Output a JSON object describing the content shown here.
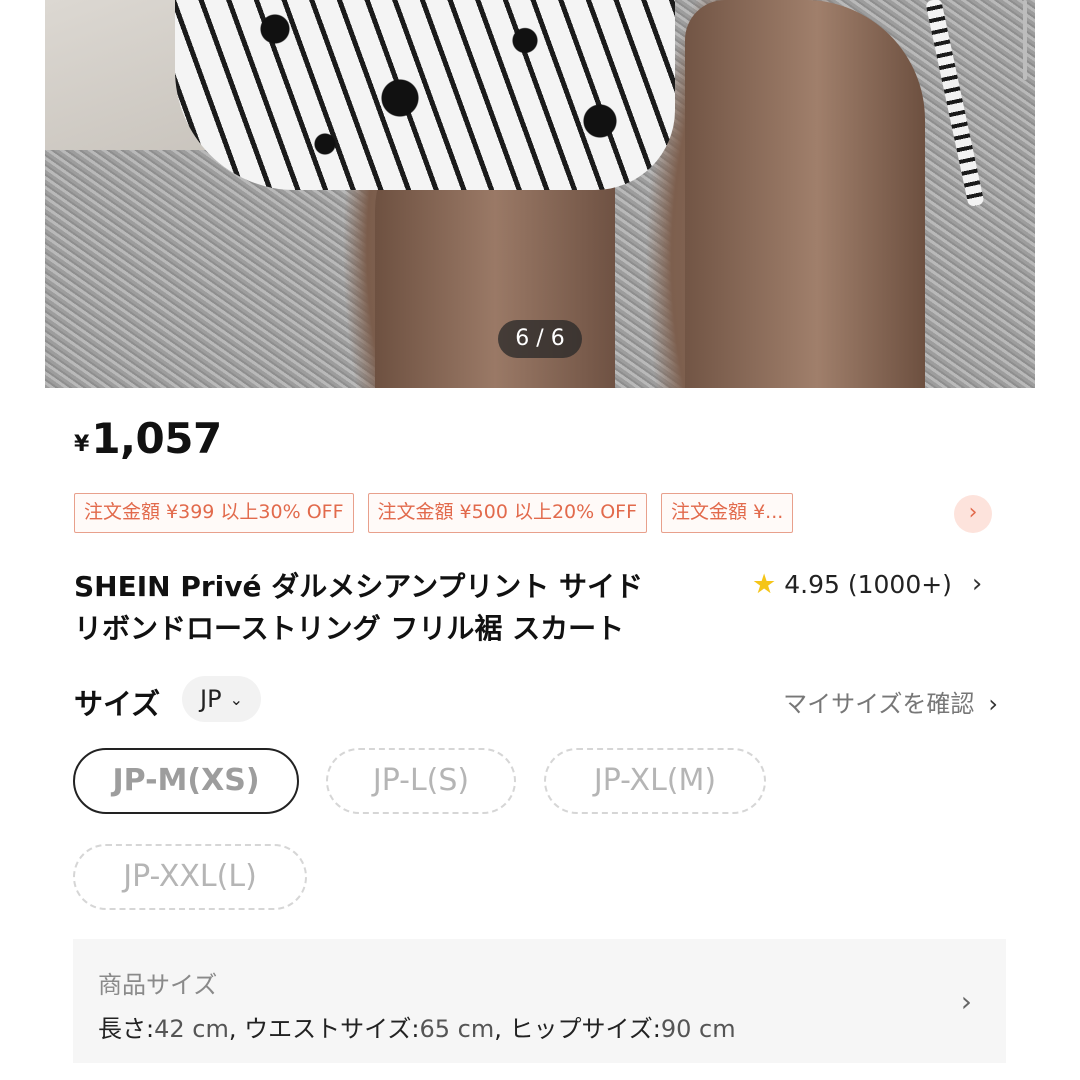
{
  "gallery": {
    "counter": "6 / 6",
    "image_alt": "product photo"
  },
  "price": {
    "currency": "¥",
    "amount": "1,057"
  },
  "coupons": [
    "注文金額 ¥399 以上30% OFF",
    "注文金額 ¥500 以上20% OFF",
    "注文金額 ¥..."
  ],
  "coupon_more_icon": "chevron-right-icon",
  "product": {
    "title_line1": "SHEIN Privé ダルメシアンプリント サイド",
    "title_line2": "リボンドローストリング フリル裾 スカート",
    "rating": "4.95",
    "rating_count": "(1000+)"
  },
  "size": {
    "label": "サイズ",
    "region": "JP",
    "my_size_link": "マイサイズを確認",
    "options": [
      "JP-M(XS)",
      "JP-L(S)",
      "JP-XL(M)",
      "JP-XXL(L)"
    ],
    "selected": "JP-M(XS)"
  },
  "measurements": {
    "title": "商品サイズ",
    "length_label": "長さ:",
    "length_value": "42 cm",
    "waist_label": "ウエストサイズ:",
    "waist_value": "65 cm",
    "hip_label": "ヒップサイズ:",
    "hip_value": "90 cm"
  },
  "colors": {
    "coupon_text": "#e26a4c",
    "coupon_border": "#e8a08c",
    "star": "#f5c518",
    "selected_border": "#222222"
  }
}
